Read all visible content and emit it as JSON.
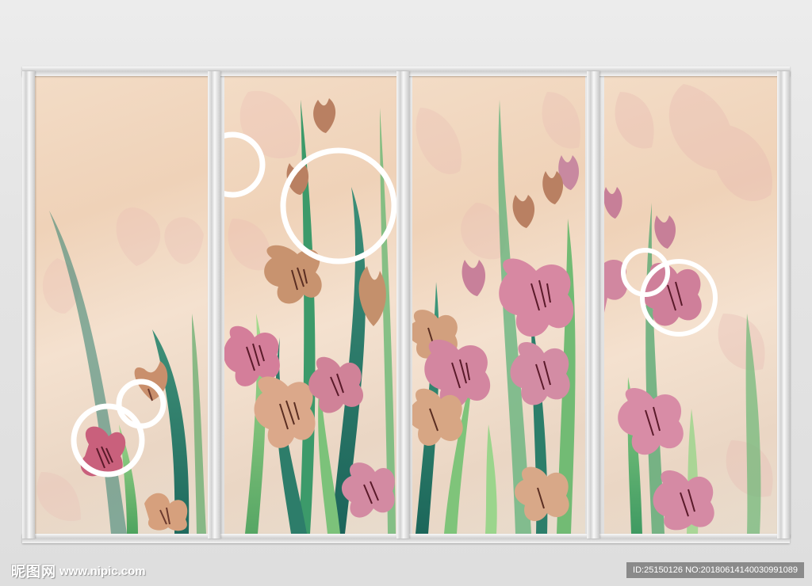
{
  "footer": {
    "logo_text": "昵图网",
    "site_url": "www.nipic.com",
    "id_text": "ID:25150126 NO:20180614140030991089"
  },
  "colors": {
    "background": "#e6e6e6",
    "frame": "#dcdcdc",
    "marble": "#f0d8c0",
    "petal_pink": "#e2a2b6",
    "petal_peach": "#d9a684",
    "leaf_dark": "#2e7a6a",
    "leaf_light": "#7cc07a",
    "ring": "#ffffff"
  },
  "scene": {
    "panels": 4,
    "subject": "flower-mural"
  }
}
